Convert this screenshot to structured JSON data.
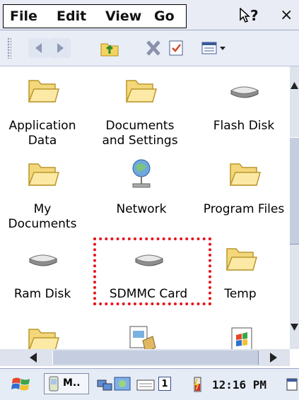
{
  "menubar": {
    "items": [
      "File",
      "Edit",
      "View",
      "Go"
    ],
    "help_label": "?",
    "close_label": "×"
  },
  "toolbar": {
    "buttons": [
      "back-icon",
      "forward-icon",
      "up-folder-icon",
      "delete-icon",
      "properties-icon",
      "views-icon"
    ]
  },
  "files": [
    {
      "name": "Application Data",
      "line1": "Application",
      "line2": "Data",
      "icon": "folder-icon"
    },
    {
      "name": "Documents and Settings",
      "line1": "Documents",
      "line2": "and Settings",
      "icon": "folder-icon"
    },
    {
      "name": "Flash Disk",
      "line1": "Flash Disk",
      "line2": "",
      "icon": "drive-icon"
    },
    {
      "name": "My Documents",
      "line1": "My",
      "line2": "Documents",
      "icon": "folder-icon"
    },
    {
      "name": "Network",
      "line1": "Network",
      "line2": "",
      "icon": "network-icon"
    },
    {
      "name": "Program Files",
      "line1": "Program Files",
      "line2": "",
      "icon": "folder-icon"
    },
    {
      "name": "Ram Disk",
      "line1": "Ram Disk",
      "line2": "",
      "icon": "drive-icon"
    },
    {
      "name": "SDMMC Card",
      "line1": "SDMMC Card",
      "line2": "",
      "icon": "drive-icon"
    },
    {
      "name": "Temp",
      "line1": "Temp",
      "line2": "",
      "icon": "folder-icon"
    }
  ],
  "taskbar": {
    "start_icon": "windows-flag-icon",
    "task_label": "M..",
    "input_indicator": "1",
    "clock": "12:16 PM"
  },
  "colors": {
    "selection_dotted": "#e8121b",
    "folder_fill": "#f6e08a",
    "menubar_bg": "#e9ecf4"
  }
}
